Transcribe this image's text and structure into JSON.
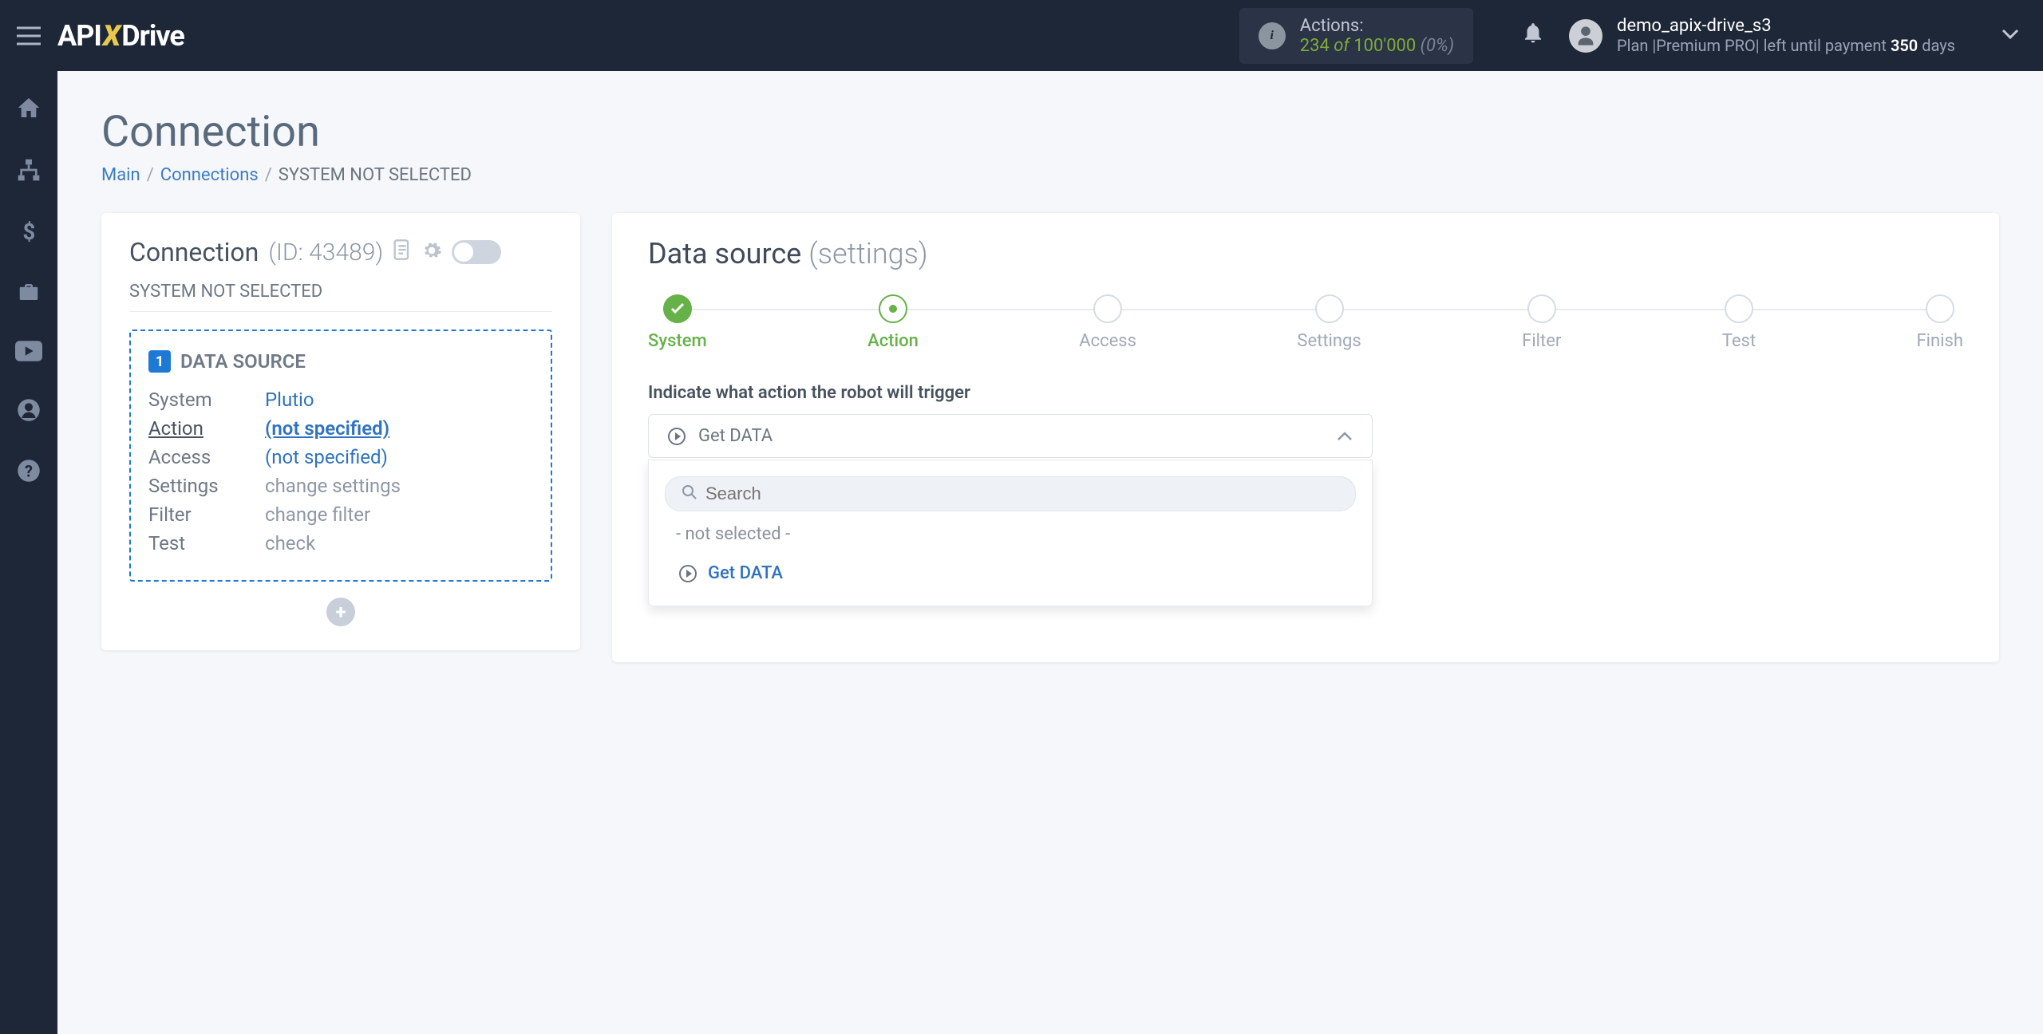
{
  "header": {
    "actions_label": "Actions:",
    "actions_count": "234",
    "actions_of": " of ",
    "actions_max": "100'000",
    "actions_pct": " (0%)",
    "user_name": "demo_apix-drive_s3",
    "plan_prefix": "Plan |",
    "plan_name": "Premium PRO",
    "plan_mid": "| left until payment ",
    "plan_days": "350",
    "plan_suffix": " days"
  },
  "page": {
    "title": "Connection",
    "bc_main": "Main",
    "bc_connections": "Connections",
    "bc_current": "SYSTEM NOT SELECTED"
  },
  "left": {
    "head_label": "Connection",
    "id_text": "(ID: 43489)",
    "subtitle": "SYSTEM NOT SELECTED",
    "badge": "1",
    "ds_title": "DATA SOURCE",
    "rows": {
      "system_l": "System",
      "system_v": "Plutio",
      "action_l": "Action",
      "action_v": "(not specified)",
      "access_l": "Access",
      "access_v": "(not specified)",
      "settings_l": "Settings",
      "settings_v": "change settings",
      "filter_l": "Filter",
      "filter_v": "change filter",
      "test_l": "Test",
      "test_v": "check"
    }
  },
  "right": {
    "title": "Data source",
    "title_sub": "(settings)",
    "prompt": "Indicate what action the robot will trigger",
    "selected": "Get DATA",
    "search_ph": "Search",
    "not_selected": "- not selected -",
    "option1": "Get DATA"
  },
  "steps": [
    "System",
    "Action",
    "Access",
    "Settings",
    "Filter",
    "Test",
    "Finish"
  ]
}
